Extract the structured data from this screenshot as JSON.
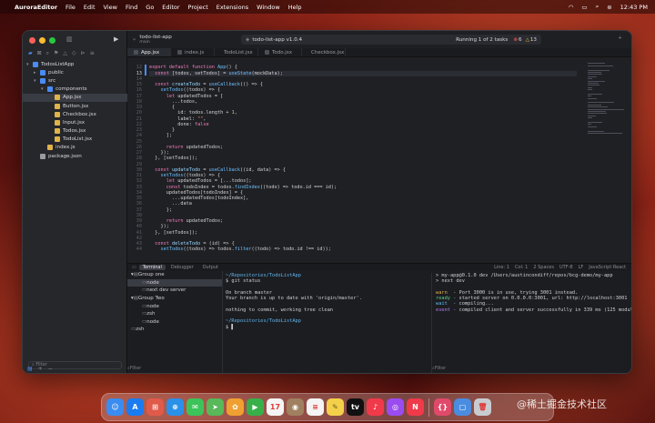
{
  "menubar": {
    "items": [
      "AuroraEditor",
      "File",
      "Edit",
      "View",
      "Find",
      "Go",
      "Editor",
      "Project",
      "Extensions",
      "Window",
      "Help"
    ],
    "time": "12:43 PM"
  },
  "sidebar": {
    "tree": [
      {
        "label": "TodosListApp",
        "depth": 0,
        "expanded": true,
        "color": "#4a8cf7"
      },
      {
        "label": "public",
        "depth": 1,
        "expanded": false,
        "color": "#4a8cf7"
      },
      {
        "label": "src",
        "depth": 1,
        "expanded": true,
        "color": "#4a8cf7"
      },
      {
        "label": "components",
        "depth": 2,
        "expanded": true,
        "color": "#4a8cf7"
      },
      {
        "label": "App.jsx",
        "depth": 3,
        "selected": true,
        "color": "#e0b34a"
      },
      {
        "label": "Button.jsx",
        "depth": 3,
        "color": "#e0b34a"
      },
      {
        "label": "Checkbox.jsx",
        "depth": 3,
        "color": "#e0b34a"
      },
      {
        "label": "Input.jsx",
        "depth": 3,
        "color": "#e0b34a"
      },
      {
        "label": "Todos.jsx",
        "depth": 3,
        "color": "#e0b34a"
      },
      {
        "label": "TodoList.jsx",
        "depth": 3,
        "color": "#e0b34a"
      },
      {
        "label": "index.js",
        "depth": 2,
        "color": "#e0b34a"
      },
      {
        "label": "package.json",
        "depth": 1,
        "color": "#9a9ba0"
      }
    ],
    "filter_placeholder": "Filter"
  },
  "titlebar": {
    "project": "todo-list-app",
    "branch": "main",
    "path": "todo-list-app v1.0.4",
    "run_status": "Running 1 of 2 tasks",
    "errors": "6",
    "warnings": "13"
  },
  "tabs": [
    "App.jsx",
    "index.js",
    "TodoList.jsx",
    "Todo.jsx",
    "Checkbox.jsx"
  ],
  "editor": {
    "line_numbers": [
      "",
      "12",
      "13",
      "14",
      "15",
      "16",
      "17",
      "18",
      "19",
      "20",
      "21",
      "22",
      "23",
      "24",
      "25",
      "26",
      "27",
      "28",
      "29",
      "30",
      "31",
      "32",
      "33",
      "34",
      "35",
      "36",
      "37",
      "38",
      "39",
      "40",
      "41",
      "42",
      "43",
      "44"
    ],
    "current_line": "13",
    "lines": [
      [],
      [
        {
          "t": "export default ",
          "c": "kw"
        },
        {
          "t": "function ",
          "c": "kw"
        },
        {
          "t": "App",
          "c": "fn"
        },
        {
          "t": "() {"
        }
      ],
      [
        {
          "t": "  "
        },
        {
          "t": "const ",
          "c": "kw"
        },
        {
          "t": "[todos, setTodos] = "
        },
        {
          "t": "useState",
          "c": "fn"
        },
        {
          "t": "(mockData);"
        }
      ],
      [],
      [
        {
          "t": "  "
        },
        {
          "t": "const ",
          "c": "kw"
        },
        {
          "t": "createTodo",
          "c": "var"
        },
        {
          "t": " = "
        },
        {
          "t": "useCallback",
          "c": "fn"
        },
        {
          "t": "(() => {"
        }
      ],
      [
        {
          "t": "    "
        },
        {
          "t": "setTodos",
          "c": "fn"
        },
        {
          "t": "((todos) => {"
        }
      ],
      [
        {
          "t": "      "
        },
        {
          "t": "let ",
          "c": "kw"
        },
        {
          "t": "updatedTodos = ["
        }
      ],
      [
        {
          "t": "        ...todos,"
        }
      ],
      [
        {
          "t": "        {"
        }
      ],
      [
        {
          "t": "          id: todos.length + "
        },
        {
          "t": "1",
          "c": "num"
        },
        {
          "t": ","
        }
      ],
      [
        {
          "t": "          label: "
        },
        {
          "t": "\"\"",
          "c": "str"
        },
        {
          "t": ","
        }
      ],
      [
        {
          "t": "          done: "
        },
        {
          "t": "false",
          "c": "kw"
        }
      ],
      [
        {
          "t": "        }"
        }
      ],
      [
        {
          "t": "      ];"
        }
      ],
      [],
      [
        {
          "t": "      "
        },
        {
          "t": "return ",
          "c": "kw"
        },
        {
          "t": "updatedTodos;"
        }
      ],
      [
        {
          "t": "    });"
        }
      ],
      [
        {
          "t": "  }, [setTodos]);"
        }
      ],
      [],
      [
        {
          "t": "  "
        },
        {
          "t": "const ",
          "c": "kw"
        },
        {
          "t": "updateTodo",
          "c": "var"
        },
        {
          "t": " = "
        },
        {
          "t": "useCallback",
          "c": "fn"
        },
        {
          "t": "((id, data) => {"
        }
      ],
      [
        {
          "t": "    "
        },
        {
          "t": "setTodos",
          "c": "fn"
        },
        {
          "t": "((todos) => {"
        }
      ],
      [
        {
          "t": "      "
        },
        {
          "t": "let ",
          "c": "kw"
        },
        {
          "t": "updatedTodos = [...todos];"
        }
      ],
      [
        {
          "t": "      "
        },
        {
          "t": "const ",
          "c": "kw"
        },
        {
          "t": "todoIndex = todos."
        },
        {
          "t": "findIndex",
          "c": "fn"
        },
        {
          "t": "((todo) => todo.id === id);"
        }
      ],
      [
        {
          "t": "      updatedTodos[todoIndex] = {"
        }
      ],
      [
        {
          "t": "        ...updatedTodos[todoIndex],"
        }
      ],
      [
        {
          "t": "        ...data"
        }
      ],
      [
        {
          "t": "      };"
        }
      ],
      [],
      [
        {
          "t": "      "
        },
        {
          "t": "return ",
          "c": "kw"
        },
        {
          "t": "updatedTodos;"
        }
      ],
      [
        {
          "t": "    });"
        }
      ],
      [
        {
          "t": "  }, [setTodos]);"
        }
      ],
      [],
      [
        {
          "t": "  "
        },
        {
          "t": "const ",
          "c": "kw"
        },
        {
          "t": "deleteTodo",
          "c": "var"
        },
        {
          "t": " = (id) => {"
        }
      ],
      [
        {
          "t": "    "
        },
        {
          "t": "setTodos",
          "c": "fn"
        },
        {
          "t": "((todos) => todos."
        },
        {
          "t": "filter",
          "c": "fn"
        },
        {
          "t": "((todo) => todo.id !== id));"
        }
      ]
    ]
  },
  "statusbar": {
    "tabs": [
      "Terminal",
      "Debugger",
      "Output"
    ],
    "info": [
      "Line: 1",
      "Col: 1",
      "2 Spaces",
      "UTF-8",
      "LF",
      "JavaScript React"
    ]
  },
  "terminal": {
    "groups": [
      {
        "label": "Group one",
        "kind": "group"
      },
      {
        "label": "node",
        "kind": "item",
        "selected": true
      },
      {
        "label": "next dev server",
        "kind": "item"
      },
      {
        "label": "Group Two",
        "kind": "group"
      },
      {
        "label": "node",
        "kind": "item"
      },
      {
        "label": "zsh",
        "kind": "item"
      },
      {
        "label": "node",
        "kind": "item"
      },
      {
        "label": "zsh",
        "kind": "top"
      }
    ],
    "pane1": [
      "~/Repositories/TodoListApp",
      "$ git status",
      "",
      "On branch master",
      "Your branch is up to date with 'origin/master'.",
      "",
      "nothing to commit, working tree clean",
      "",
      "~/Repositories/TodoListApp",
      "$ ▌"
    ],
    "pane2": [
      "> my-app@0.1.0 dev /Users/austincondiff/repos/bcg-demo/my-app",
      "> next dev",
      "",
      "warn  - Port 3000 is in use, trying 3001 instead.",
      "ready - started server on 0.0.0.0:3001, url: http://localhost:3001",
      "wait  - compiling...",
      "event - compiled client and server successfully in 339 ms (125 modules)"
    ],
    "pane2_prefix_colors": [
      "#d0d0d4",
      "#d0d0d4",
      "#d0d0d4",
      "#e0b34a",
      "#5fd38a",
      "#5fb8f0",
      "#b080f0"
    ],
    "filter_placeholder": "Filter",
    "bottom_icons": [
      "+",
      "−"
    ]
  },
  "dock": {
    "apps": [
      {
        "name": "finder",
        "color": "#3b8cf0",
        "glyph": "☺"
      },
      {
        "name": "app-store",
        "color": "#1a7cf0",
        "glyph": "A"
      },
      {
        "name": "launchpad",
        "color": "#e05a4a",
        "glyph": "⊞"
      },
      {
        "name": "safari",
        "color": "#2a90e8",
        "glyph": "⊕"
      },
      {
        "name": "messages",
        "color": "#3cc45a",
        "glyph": "✉"
      },
      {
        "name": "maps",
        "color": "#58b85a",
        "glyph": "➤"
      },
      {
        "name": "photos",
        "color": "#f0a030",
        "glyph": "✿"
      },
      {
        "name": "facetime",
        "color": "#38b04a",
        "glyph": "▶"
      },
      {
        "name": "calendar",
        "color": "#f4f4f4",
        "glyph": "17"
      },
      {
        "name": "contacts",
        "color": "#a08060",
        "glyph": "◉"
      },
      {
        "name": "reminders",
        "color": "#f4f4f4",
        "glyph": "≡"
      },
      {
        "name": "notes",
        "color": "#f4d04a",
        "glyph": "✎"
      },
      {
        "name": "tv",
        "color": "#111111",
        "glyph": "tv"
      },
      {
        "name": "music",
        "color": "#f03a4a",
        "glyph": "♪"
      },
      {
        "name": "podcasts",
        "color": "#9a4cf0",
        "glyph": "◎"
      },
      {
        "name": "news",
        "color": "#f03a4a",
        "glyph": "N"
      },
      {
        "name": "aurora-editor",
        "color": "#e04a6a",
        "glyph": "{}"
      },
      {
        "name": "downloads",
        "color": "#4a8ce0",
        "glyph": "▢"
      },
      {
        "name": "trash",
        "color": "#c8ccd0",
        "glyph": "🗑"
      }
    ]
  },
  "watermark": "@稀土掘金技术社区",
  "colors": {
    "accent": "#4a8cf7",
    "keyword": "#f57fbe",
    "function": "#6cc0ff",
    "string": "#ff8a6a",
    "number": "#d9c97c"
  }
}
